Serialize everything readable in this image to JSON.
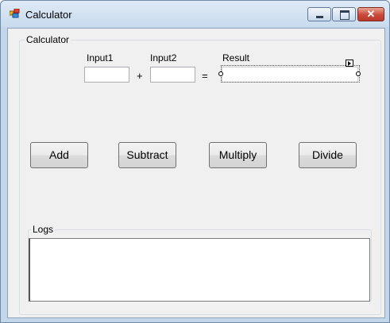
{
  "window": {
    "title": "Calculator",
    "icon": "calculator-app-icon"
  },
  "caption_buttons": {
    "minimize": "minimize-icon",
    "maximize": "maximize-icon",
    "close": "✕"
  },
  "calculator_group": {
    "label": "Calculator",
    "input1": {
      "label": "Input1",
      "value": ""
    },
    "plus": "+",
    "input2": {
      "label": "Input2",
      "value": ""
    },
    "equals": "=",
    "result": {
      "label": "Result",
      "value": ""
    }
  },
  "buttons": {
    "add": "Add",
    "subtract": "Subtract",
    "multiply": "Multiply",
    "divide": "Divide"
  },
  "logs_group": {
    "label": "Logs",
    "content": ""
  },
  "colors": {
    "titlebar": "#c8dbee",
    "client": "#f0f0f0",
    "close_button": "#c9483a"
  }
}
